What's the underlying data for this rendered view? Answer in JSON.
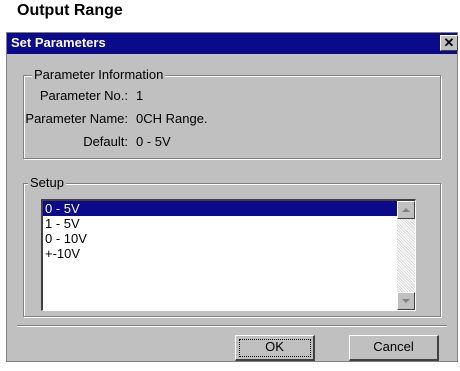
{
  "caption": "Output Range",
  "dialog": {
    "title": "Set Parameters",
    "close_glyph": "✕"
  },
  "parameter_info": {
    "legend": "Parameter Information",
    "rows": [
      {
        "label": "Parameter No.:",
        "value": "1"
      },
      {
        "label": "Parameter Name:",
        "value": "0CH Range."
      },
      {
        "label": "Default:",
        "value": "0 - 5V"
      }
    ]
  },
  "setup": {
    "legend": "Setup",
    "options": [
      "0 - 5V",
      "1 - 5V",
      "0 - 10V",
      "+-10V"
    ],
    "selected_index": 0
  },
  "buttons": {
    "ok": "OK",
    "cancel": "Cancel"
  }
}
